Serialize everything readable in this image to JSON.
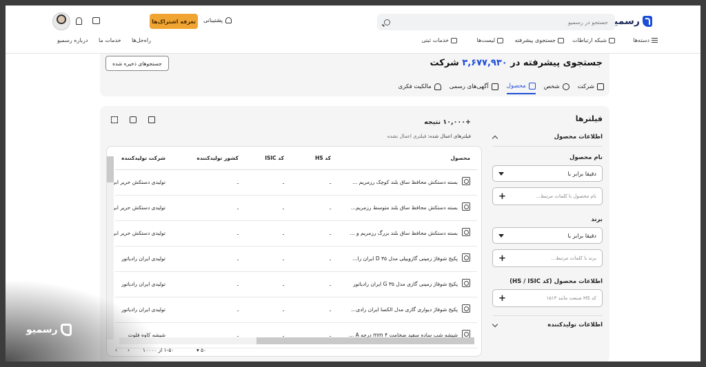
{
  "header": {
    "logo_text": "رسمیو",
    "search_placeholder": "جستجو در رسمیو",
    "subscription_button": "تعرفه اشتراک‌ها",
    "support_label": "پشتیبانی",
    "nav": {
      "categories": "دسته‌ها",
      "network": "شبکه ارتباطات",
      "advanced_search": "جستجوی پیشرفته",
      "lists": "لیست‌ها",
      "registration": "خدمات ثبتی",
      "solutions": "راه‌حل‌ها",
      "services": "خدمات ما",
      "about": "درباره رسمیو"
    }
  },
  "page": {
    "title_prefix": "جستجوی پیشرفته در",
    "title_count": "۳,۶۷۷,۹۳۰",
    "title_suffix": "شرکت",
    "saved_searches_button": "جستجوهای ذخیره شده",
    "tabs": [
      {
        "label": "شرکت",
        "icon": "building-icon"
      },
      {
        "label": "شخص",
        "icon": "person-icon"
      },
      {
        "label": "محصول",
        "icon": "product-icon",
        "active": true
      },
      {
        "label": "آگهی‌های رسمی",
        "icon": "document-icon"
      },
      {
        "label": "مالکیت فکری",
        "icon": "bulb-icon"
      }
    ]
  },
  "filters": {
    "title": "فیلترها",
    "product_info": "اطلاعات محصول",
    "product_name_label": "نام محصول",
    "product_name_match": "دقیقا برابر با",
    "product_name_placeholder": "نام محصول با کلمات مرتبط...",
    "brand_label": "برند",
    "brand_match": "دقیقا برابر با",
    "brand_placeholder": "برند با کلمات مرتبط...",
    "codes_label": "اطلاعات محصول (کد HS / ISIC)",
    "codes_placeholder": "کد HS صنعت مانند ۱۵۱۳",
    "manufacturer_info": "اطلاعات تولیدکننده"
  },
  "results": {
    "count_text": "+۱۰,۰۰۰ نتیجه",
    "applied_label": "فیلترهای اعمال شده:",
    "applied_value": "فیلتری اعمال نشده",
    "columns": {
      "product": "محصول",
      "hs": "کد HS",
      "isic": "کد ISIC",
      "country": "کشور تولیدکننده",
      "manufacturer": "شرکت تولیدکننده"
    },
    "rows": [
      {
        "product": "بسته دستکش محافظ ساق بلند کوچک رزمریم ...",
        "hs": "ـ",
        "isic": "ـ",
        "country": "ـ",
        "manufacturer": "تولیدی دستکش حریر ابریشم"
      },
      {
        "product": "بسته دستکش محافظ ساق بلند متوسط رزمریم...",
        "hs": "ـ",
        "isic": "ـ",
        "country": "ـ",
        "manufacturer": "تولیدی دستکش حریر ابریشم"
      },
      {
        "product": "بسته دستکش محافظ ساق بلند بزرگ رزمریم و ...",
        "hs": "ـ",
        "isic": "ـ",
        "country": "ـ",
        "manufacturer": "تولیدی دستکش حریر ابریشم"
      },
      {
        "product": "پکیج شوفاژ زمینی گازوییلی مدل D ۳۵ ایران را...",
        "hs": "ـ",
        "isic": "ـ",
        "country": "ـ",
        "manufacturer": "تولیدی ایران رادیاتور"
      },
      {
        "product": "پکیج شوفاژ زمینی گازی مدل G ۳۵ ایران رادیاتور",
        "hs": "ـ",
        "isic": "ـ",
        "country": "ـ",
        "manufacturer": "تولیدی ایران رادیاتور"
      },
      {
        "product": "پکیج شوفاژ دیواری گازی مدل الکسا ایران رادی...",
        "hs": "ـ",
        "isic": "ـ",
        "country": "ـ",
        "manufacturer": "تولیدی ایران رادیاتور"
      },
      {
        "product": "شیشه شب ساده سفید ضخامت ۴ mm درجه A ...",
        "hs": "ـ",
        "isic": "ـ",
        "country": "ـ",
        "manufacturer": "شیشه کاوه فلوت"
      }
    ],
    "pager_range": "۱-۵۰ از ۱۰۰۰۰",
    "page_size": "۵۰"
  },
  "watermark": "رسمیو"
}
